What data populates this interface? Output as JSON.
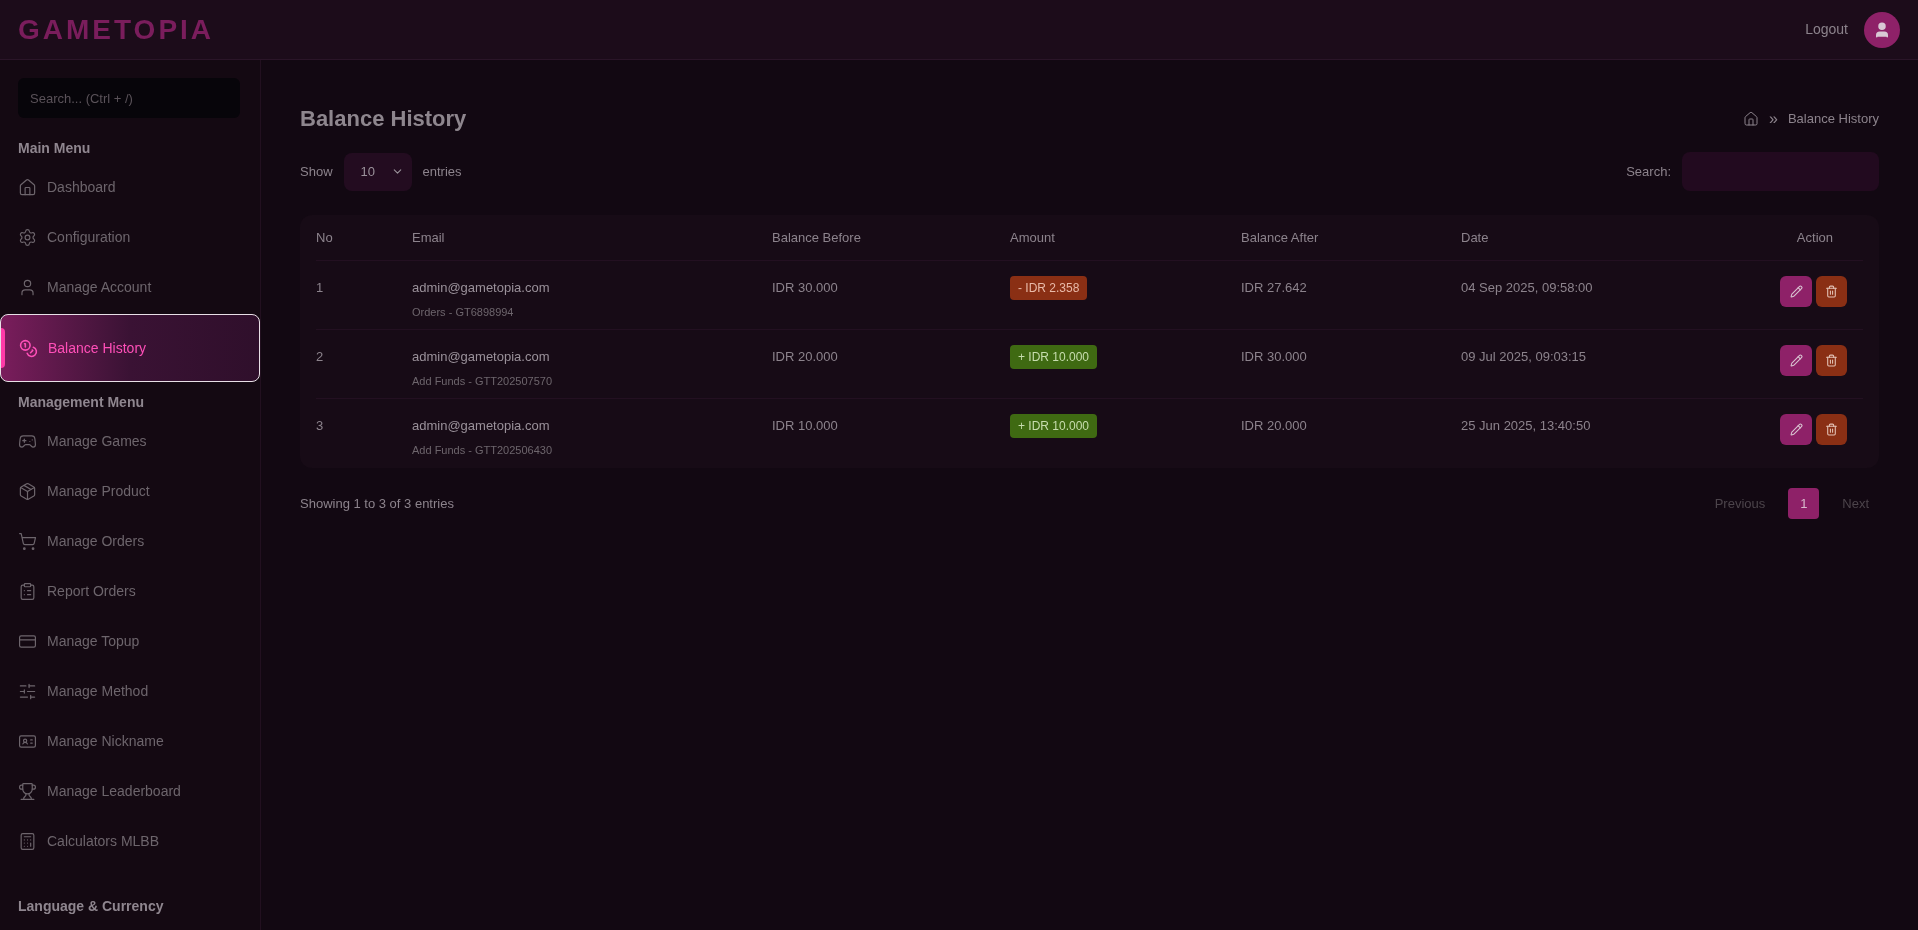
{
  "header": {
    "logo": "GAMETOPIA",
    "logout": "Logout"
  },
  "sidebar": {
    "search": {
      "placeholder": "Search... (Ctrl + /)"
    },
    "sections": [
      {
        "title": "Main Menu",
        "items": [
          {
            "label": "Dashboard",
            "selected": false
          },
          {
            "label": "Configuration",
            "selected": false
          },
          {
            "label": "Manage Account",
            "selected": false
          },
          {
            "label": "Balance History",
            "selected": true
          }
        ]
      },
      {
        "title": "Management Menu",
        "items": [
          {
            "label": "Manage Games",
            "selected": false
          },
          {
            "label": "Manage Product",
            "selected": false
          },
          {
            "label": "Manage Orders",
            "selected": false
          },
          {
            "label": "Report Orders",
            "selected": false
          },
          {
            "label": "Manage Topup",
            "selected": false
          },
          {
            "label": "Manage Method",
            "selected": false
          },
          {
            "label": "Manage Nickname",
            "selected": false
          },
          {
            "label": "Manage Leaderboard",
            "selected": false
          },
          {
            "label": "Calculators MLBB",
            "selected": false
          }
        ]
      },
      {
        "title": "Language & Currency"
      }
    ]
  },
  "page": {
    "title": "Balance History",
    "breadcrumb": "Balance History",
    "separator": "»"
  },
  "table_controls": {
    "show": "Show",
    "entries_value": "10",
    "entries": "entries",
    "search_label": "Search:"
  },
  "table": {
    "columns": [
      "No",
      "Email",
      "Balance Before",
      "Amount",
      "Balance After",
      "Date",
      "Action"
    ],
    "rows": [
      {
        "no": "1",
        "email": "admin@gametopia.com",
        "ref": "Orders - GT6898994",
        "before": "IDR 30.000",
        "amount": "- IDR 2.358",
        "kind": "debit",
        "after": "IDR 27.642",
        "date": "04 Sep 2025, 09:58:00"
      },
      {
        "no": "2",
        "email": "admin@gametopia.com",
        "ref": "Add Funds - GTT202507570",
        "before": "IDR 20.000",
        "amount": "+ IDR 10.000",
        "kind": "credit",
        "after": "IDR 30.000",
        "date": "09 Jul 2025, 09:03:15"
      },
      {
        "no": "3",
        "email": "admin@gametopia.com",
        "ref": "Add Funds - GTT202506430",
        "before": "IDR 10.000",
        "amount": "+ IDR 10.000",
        "kind": "credit",
        "after": "IDR 20.000",
        "date": "25 Jun 2025, 13:40:50"
      }
    ]
  },
  "footer": {
    "info": "Showing 1 to 3 of 3 entries",
    "pagination": [
      {
        "label": "Previous",
        "kind": "prev",
        "disabled": true,
        "selected": false
      },
      {
        "label": "1",
        "kind": "page",
        "disabled": false,
        "selected": true
      },
      {
        "label": "Next",
        "kind": "next",
        "disabled": true,
        "selected": false
      }
    ]
  }
}
